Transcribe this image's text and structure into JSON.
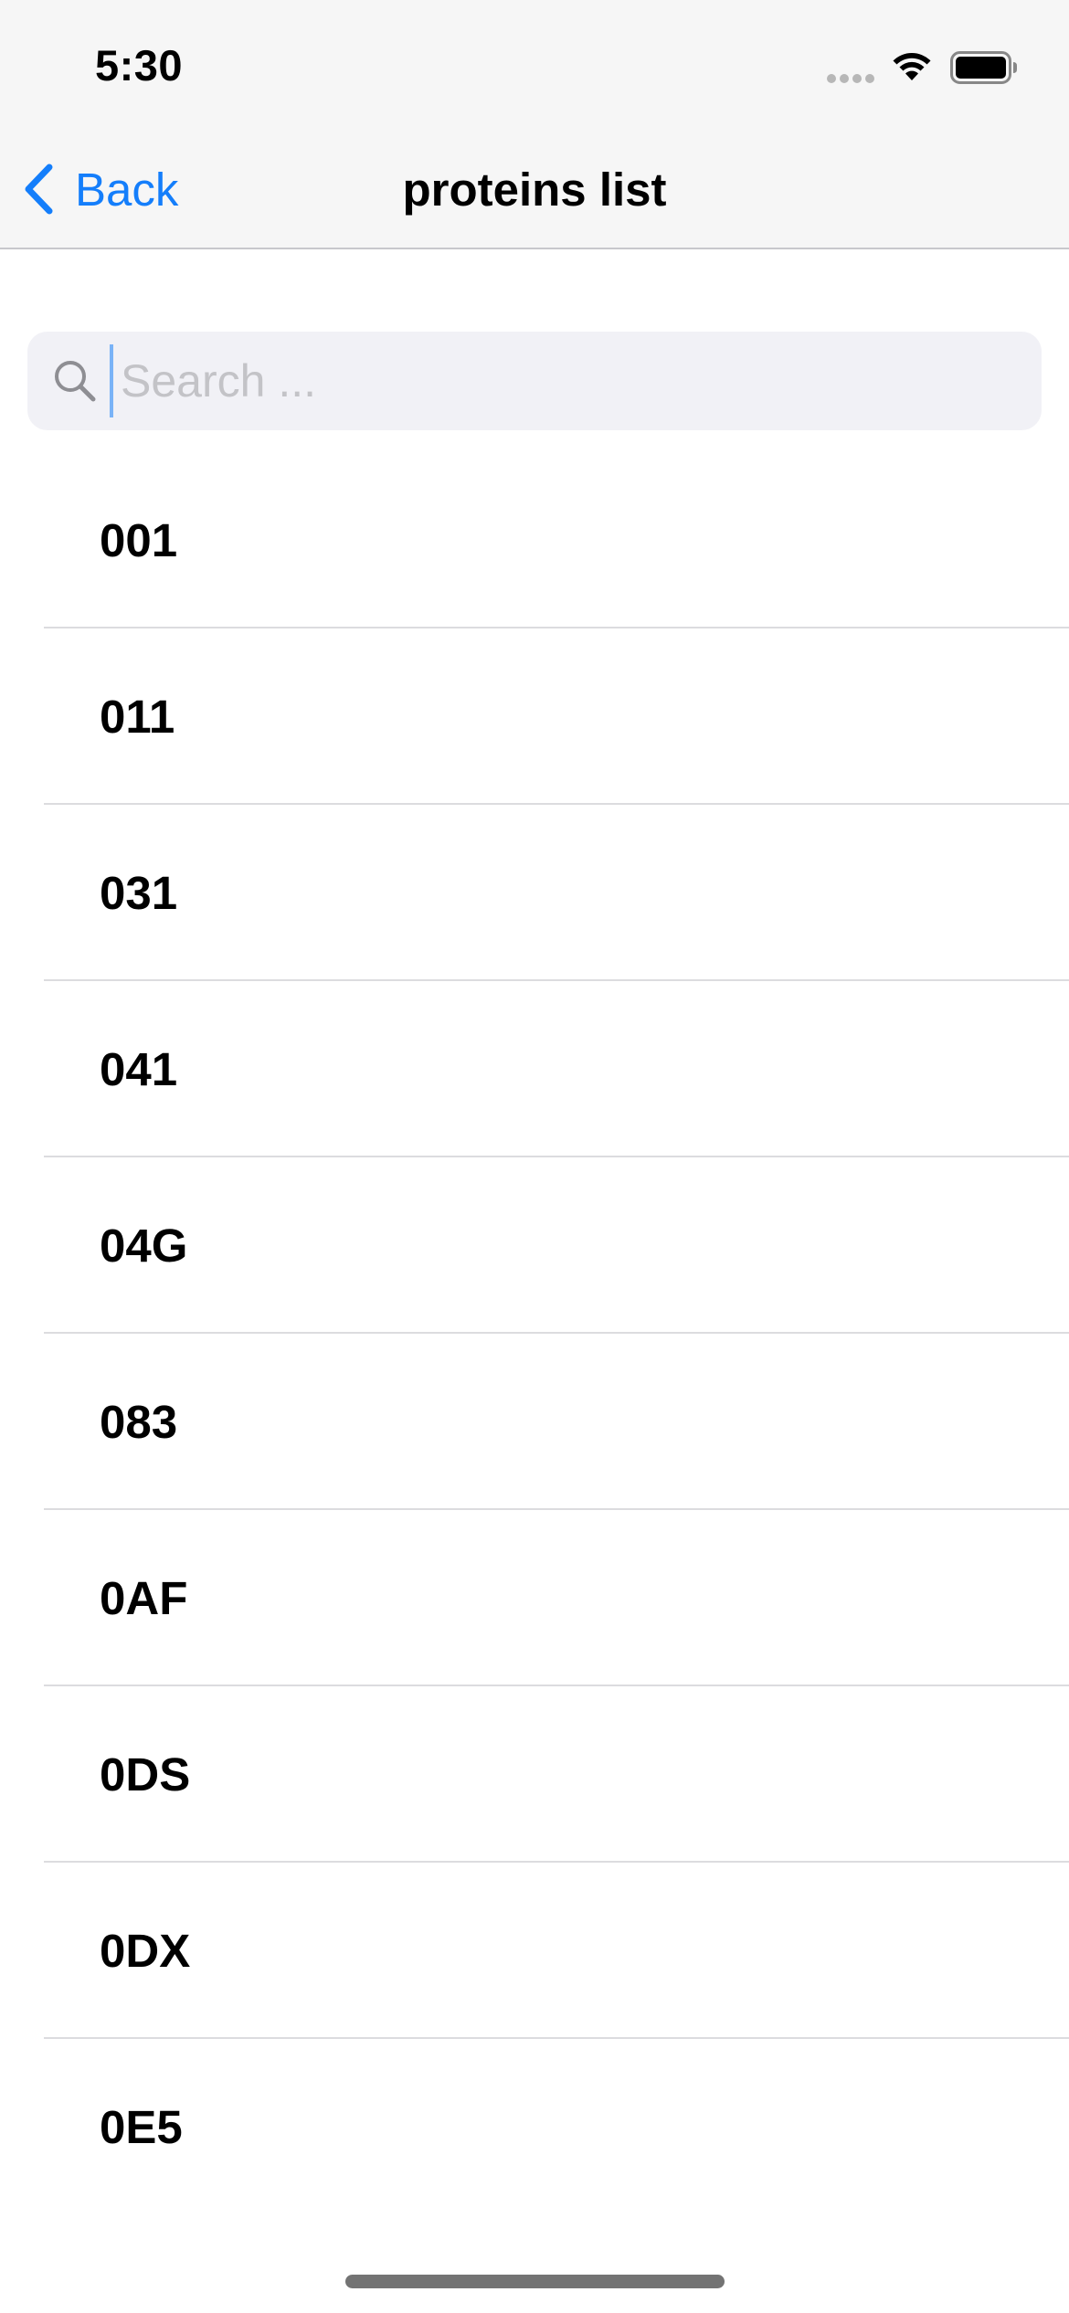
{
  "status_bar": {
    "time": "5:30",
    "icons": [
      "cellular-signal-icon",
      "wifi-icon",
      "battery-icon"
    ]
  },
  "nav": {
    "back_label": "Back",
    "back_icon": "chevron-left-icon",
    "title": "proteins list"
  },
  "search": {
    "icon": "search-icon",
    "placeholder": "Search ...",
    "value": ""
  },
  "proteins": [
    {
      "label": "001"
    },
    {
      "label": "011"
    },
    {
      "label": "031"
    },
    {
      "label": "041"
    },
    {
      "label": "04G"
    },
    {
      "label": "083"
    },
    {
      "label": "0AF"
    },
    {
      "label": "0DS"
    },
    {
      "label": "0DX"
    },
    {
      "label": "0E5"
    }
  ],
  "colors": {
    "accent": "#147efb",
    "header_bg": "#f6f6f6",
    "search_bg": "#f1f1f6",
    "separator": "#dcdcdf"
  }
}
